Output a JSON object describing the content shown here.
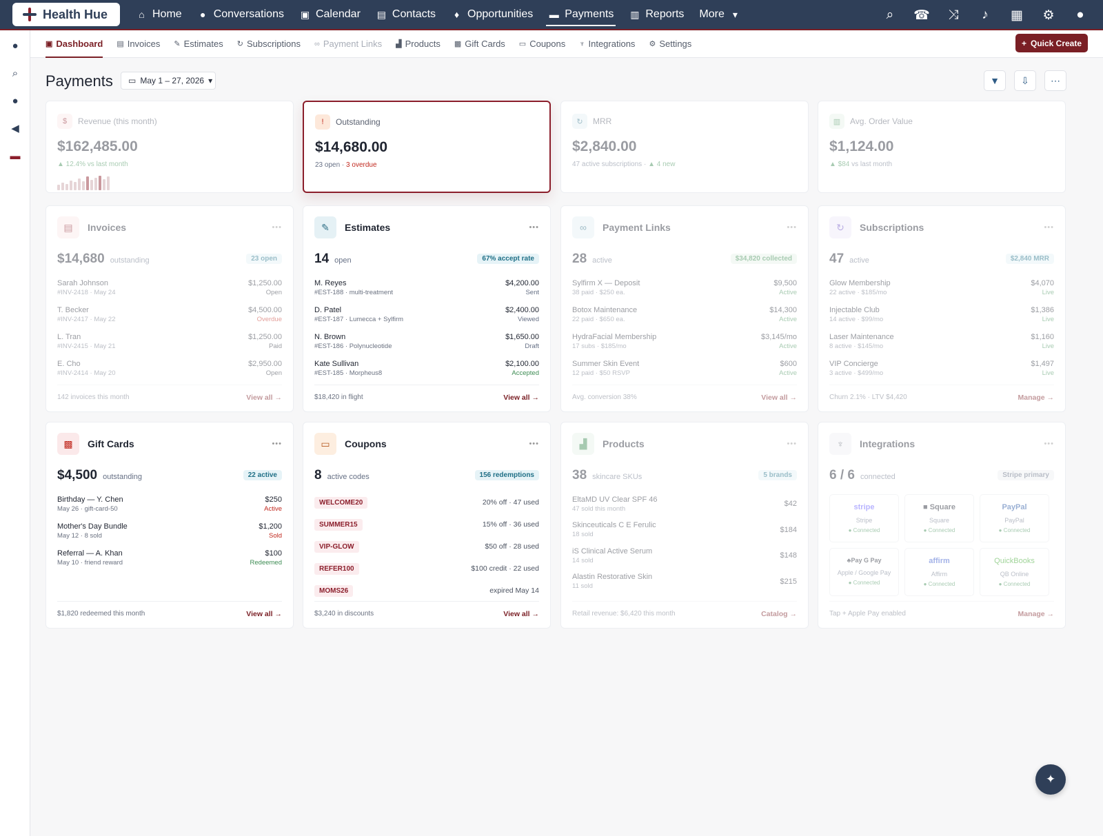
{
  "topbar": {
    "brand": "Health Hue",
    "nav": [
      "Home",
      "Conversations",
      "Calendar",
      "Contacts",
      "Opportunities",
      "Payments",
      "Reports",
      "More"
    ]
  },
  "subnav": {
    "items": [
      "Dashboard",
      "Invoices",
      "Estimates",
      "Subscriptions",
      "Payment Links",
      "Products",
      "Gift Cards",
      "Coupons",
      "Integrations",
      "Settings"
    ],
    "quick_create": "Quick Create"
  },
  "page": {
    "title": "Payments",
    "date_range": "May 1 – 27, 2026"
  },
  "kpis": [
    {
      "label": "Revenue (this month)",
      "value": "$162,485.00",
      "sub": "▲ 12.4% vs last month"
    },
    {
      "label": "Outstanding",
      "value": "$14,680.00",
      "sub_a": "23 open · ",
      "sub_b": "3 overdue"
    },
    {
      "label": "MRR",
      "value": "$2,840.00",
      "sub_a": "47 active subscriptions · ",
      "sub_b": "▲ 4 new"
    },
    {
      "label": "Avg. Order Value",
      "value": "$1,124.00",
      "sub_a": "▲ $84",
      "sub_b": " vs last month"
    }
  ],
  "invoices": {
    "title": "Invoices",
    "big": "$14,680",
    "unit": "outstanding",
    "pill": "23 open",
    "rows": [
      {
        "name": "Sarah Johnson",
        "meta": "#INV-2418 · May 24",
        "amount": "$1,250.00",
        "status": "Open"
      },
      {
        "name": "T. Becker",
        "meta": "#INV-2417 · May 22",
        "amount": "$4,500.00",
        "status": "Overdue"
      },
      {
        "name": "L. Tran",
        "meta": "#INV-2415 · May 21",
        "amount": "$1,250.00",
        "status": "Paid"
      },
      {
        "name": "E. Cho",
        "meta": "#INV-2414 · May 20",
        "amount": "$2,950.00",
        "status": "Open"
      }
    ],
    "foot": "142 invoices this month",
    "link": "View all →"
  },
  "estimates": {
    "title": "Estimates",
    "big": "14",
    "unit": "open",
    "pill": "67% accept rate",
    "rows": [
      {
        "name": "M. Reyes",
        "meta": "#EST-188 · multi-treatment",
        "amount": "$4,200.00",
        "status": "Sent"
      },
      {
        "name": "D. Patel",
        "meta": "#EST-187 · Lumecca + Sylfirm",
        "amount": "$2,400.00",
        "status": "Viewed"
      },
      {
        "name": "N. Brown",
        "meta": "#EST-186 · Polynucleotide",
        "amount": "$1,650.00",
        "status": "Draft"
      },
      {
        "name": "Kate Sullivan",
        "meta": "#EST-185 · Morpheus8",
        "amount": "$2,100.00",
        "status": "Accepted"
      }
    ],
    "foot": "$18,420 in flight",
    "link": "View all →"
  },
  "payment_links": {
    "title": "Payment Links",
    "big": "28",
    "unit": "active",
    "pill": "$34,820 collected",
    "rows": [
      {
        "name": "Sylfirm X — Deposit",
        "meta": "38 paid · $250 ea.",
        "amount": "$9,500",
        "status": "Active"
      },
      {
        "name": "Botox Maintenance",
        "meta": "22 paid · $650 ea.",
        "amount": "$14,300",
        "status": "Active"
      },
      {
        "name": "HydraFacial Membership",
        "meta": "17 subs · $185/mo",
        "amount": "$3,145/mo",
        "status": "Active"
      },
      {
        "name": "Summer Skin Event",
        "meta": "12 paid · $50 RSVP",
        "amount": "$600",
        "status": "Active"
      }
    ],
    "foot": "Avg. conversion 38%",
    "link": "View all →"
  },
  "subscriptions": {
    "title": "Subscriptions",
    "big": "47",
    "unit": "active",
    "pill": "$2,840 MRR",
    "rows": [
      {
        "name": "Glow Membership",
        "meta": "22 active · $185/mo",
        "amount": "$4,070",
        "status": "Live"
      },
      {
        "name": "Injectable Club",
        "meta": "14 active · $99/mo",
        "amount": "$1,386",
        "status": "Live"
      },
      {
        "name": "Laser Maintenance",
        "meta": "8 active · $145/mo",
        "amount": "$1,160",
        "status": "Live"
      },
      {
        "name": "VIP Concierge",
        "meta": "3 active · $499/mo",
        "amount": "$1,497",
        "status": "Live"
      }
    ],
    "foot": "Churn 2.1% · LTV $4,420",
    "link": "Manage →"
  },
  "gift_cards": {
    "title": "Gift Cards",
    "big": "$4,500",
    "unit": "outstanding",
    "pill": "22 active",
    "rows": [
      {
        "name": "Birthday — Y. Chen",
        "meta": "May 26 · gift-card-50",
        "amount": "$250",
        "status": "Active"
      },
      {
        "name": "Mother's Day Bundle",
        "meta": "May 12 · 8 sold",
        "amount": "$1,200",
        "status": "Sold"
      },
      {
        "name": "Referral — A. Khan",
        "meta": "May 10 · friend reward",
        "amount": "$100",
        "status": "Redeemed"
      }
    ],
    "foot": "$1,820 redeemed this month",
    "link": "View all →"
  },
  "coupons": {
    "title": "Coupons",
    "big": "8",
    "unit": "active codes",
    "pill": "156 redemptions",
    "rows": [
      {
        "code": "WELCOME20",
        "info": "20% off · 47 used"
      },
      {
        "code": "SUMMER15",
        "info": "15% off · 36 used"
      },
      {
        "code": "VIP-GLOW",
        "info": "$50 off · 28 used"
      },
      {
        "code": "REFER100",
        "info": "$100 credit · 22 used"
      },
      {
        "code": "MOMS26",
        "info": "expired May 14"
      }
    ],
    "foot": "$3,240 in discounts",
    "link": "View all →"
  },
  "products": {
    "title": "Products",
    "big": "38",
    "unit": "skincare SKUs",
    "pill": "5 brands",
    "rows": [
      {
        "name": "EltaMD UV Clear SPF 46",
        "meta": "47 sold this month",
        "price": "$42"
      },
      {
        "name": "Skinceuticals C E Ferulic",
        "meta": "18 sold",
        "price": "$184"
      },
      {
        "name": "iS Clinical Active Serum",
        "meta": "14 sold",
        "price": "$148"
      },
      {
        "name": "Alastin Restorative Skin",
        "meta": "11 sold",
        "price": "$215"
      }
    ],
    "foot": "Retail revenue: $6,420 this month",
    "link": "Catalog →"
  },
  "integrations": {
    "title": "Integrations",
    "big": "6 / 6",
    "unit": "connected",
    "pill": "Stripe primary",
    "tiles": [
      {
        "logo": "stripe",
        "label": "Stripe",
        "status": "● Connected"
      },
      {
        "logo": "■ Square",
        "label": "Square",
        "status": "● Connected"
      },
      {
        "logo": "PayPal",
        "label": "PayPal",
        "status": "● Connected"
      },
      {
        "logo": "♣Pay  G Pay",
        "label": "Apple / Google Pay",
        "status": "● Connected"
      },
      {
        "logo": "affirm",
        "label": "Affirm",
        "status": "● Connected"
      },
      {
        "logo": "QuickBooks",
        "label": "QB Online",
        "status": "● Connected"
      }
    ],
    "foot": "Tap + Apple Pay enabled",
    "link": "Manage →"
  },
  "colors": {
    "brand": "#7a1f25",
    "topbar": "#2f3f58"
  }
}
